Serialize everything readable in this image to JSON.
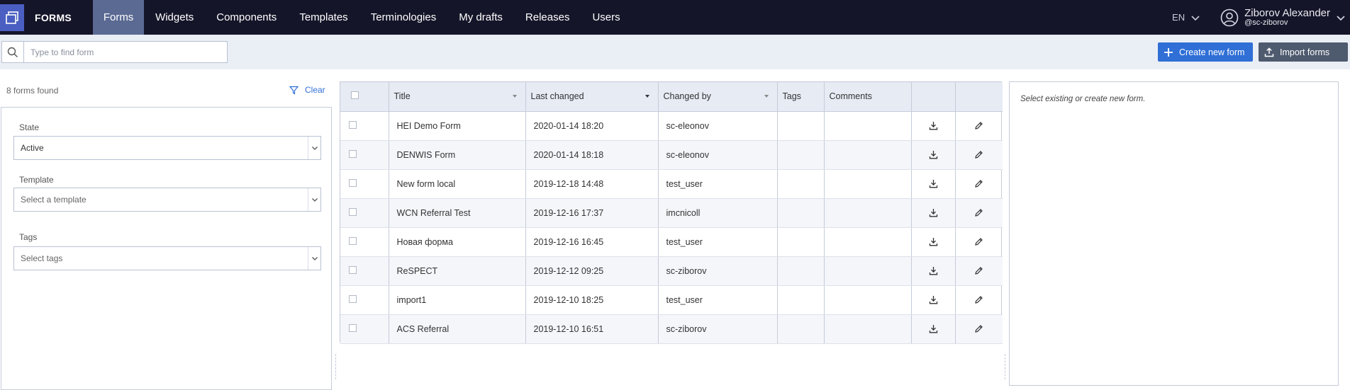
{
  "app": {
    "brand": "FORMS"
  },
  "nav": {
    "items": [
      {
        "label": "Forms",
        "active": true
      },
      {
        "label": "Widgets",
        "active": false
      },
      {
        "label": "Components",
        "active": false
      },
      {
        "label": "Templates",
        "active": false
      },
      {
        "label": "Terminologies",
        "active": false
      },
      {
        "label": "My drafts",
        "active": false
      },
      {
        "label": "Releases",
        "active": false
      },
      {
        "label": "Users",
        "active": false
      }
    ],
    "language": "EN",
    "user": {
      "name": "Ziborov Alexander",
      "handle": "@sc-ziborov"
    }
  },
  "toolbar": {
    "search_placeholder": "Type to find form",
    "create_label": "Create new form",
    "import_label": "Import forms"
  },
  "filters": {
    "found_text": "8 forms found",
    "clear_label": "Clear",
    "state": {
      "label": "State",
      "value": "Active"
    },
    "template": {
      "label": "Template",
      "placeholder": "Select a template"
    },
    "tags": {
      "label": "Tags",
      "placeholder": "Select tags"
    }
  },
  "table": {
    "columns": [
      "Title",
      "Last changed",
      "Changed by",
      "Tags",
      "Comments"
    ],
    "rows": [
      {
        "title": "HEI Demo Form",
        "last_changed": "2020-01-14 18:20",
        "changed_by": "sc-eleonov",
        "tags": "",
        "comments": ""
      },
      {
        "title": "DENWIS Form",
        "last_changed": "2020-01-14 18:18",
        "changed_by": "sc-eleonov",
        "tags": "",
        "comments": ""
      },
      {
        "title": "New form local",
        "last_changed": "2019-12-18 14:48",
        "changed_by": "test_user",
        "tags": "",
        "comments": ""
      },
      {
        "title": "WCN Referral Test",
        "last_changed": "2019-12-16 17:37",
        "changed_by": "imcnicoll",
        "tags": "",
        "comments": ""
      },
      {
        "title": "Новая форма",
        "last_changed": "2019-12-16 16:45",
        "changed_by": "test_user",
        "tags": "",
        "comments": ""
      },
      {
        "title": "ReSPECT",
        "last_changed": "2019-12-12 09:25",
        "changed_by": "sc-ziborov",
        "tags": "",
        "comments": ""
      },
      {
        "title": "import1",
        "last_changed": "2019-12-10 18:25",
        "changed_by": "test_user",
        "tags": "",
        "comments": ""
      },
      {
        "title": "ACS Referral",
        "last_changed": "2019-12-10 16:51",
        "changed_by": "sc-ziborov",
        "tags": "",
        "comments": ""
      }
    ]
  },
  "detail": {
    "empty_message": "Select existing or create new form."
  },
  "colors": {
    "nav_bg": "#15152a",
    "nav_active": "#5b6a93",
    "primary": "#2f6fd6",
    "secondary": "#4e5a6e",
    "logo": "#4a5fc1"
  }
}
